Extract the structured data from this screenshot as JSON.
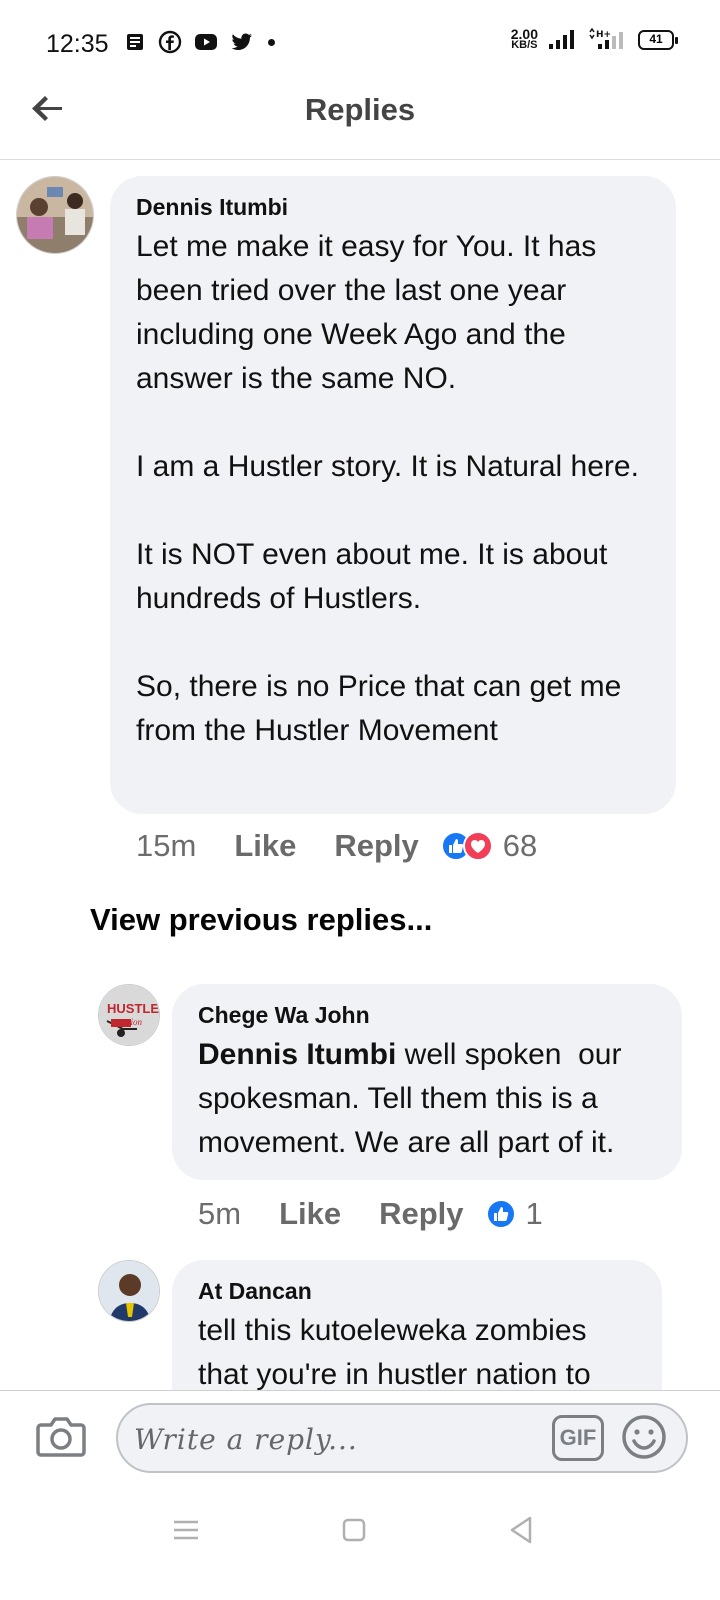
{
  "status_bar": {
    "time": "12:35",
    "net_speed_value": "2.00",
    "net_speed_unit": "KB/S",
    "battery": "41",
    "network_type": "H+"
  },
  "header": {
    "title": "Replies"
  },
  "comments": [
    {
      "author": "Dennis Itumbi",
      "text": "Let me make it easy for You. It has been tried over the last one year including one Week Ago and the answer is the same NO.\n\nI am a Hustler story. It is Natural here.\n\nIt is NOT even about me. It is about hundreds of Hustlers.\n\nSo, there is no Price that can get me from the Hustler Movement",
      "time": "15m",
      "like_label": "Like",
      "reply_label": "Reply",
      "reaction_count": "68"
    },
    {
      "author": "Chege Wa John",
      "mention": "Dennis Itumbi",
      "text": " well spoken  our spokesman. Tell them this is a movement. We are all part of it.",
      "time": "5m",
      "like_label": "Like",
      "reply_label": "Reply",
      "reaction_count": "1"
    },
    {
      "author": "At Dancan",
      "text": "tell this kutoeleweka zombies that you're in hustler nation to"
    }
  ],
  "view_previous": "View previous replies...",
  "composer": {
    "placeholder": "Write a reply...",
    "gif_label": "GIF"
  },
  "colors": {
    "bubble": "#f0f2f5",
    "like_blue": "#1877f2",
    "love_red": "#f33e58",
    "meta_gray": "#65676b"
  }
}
